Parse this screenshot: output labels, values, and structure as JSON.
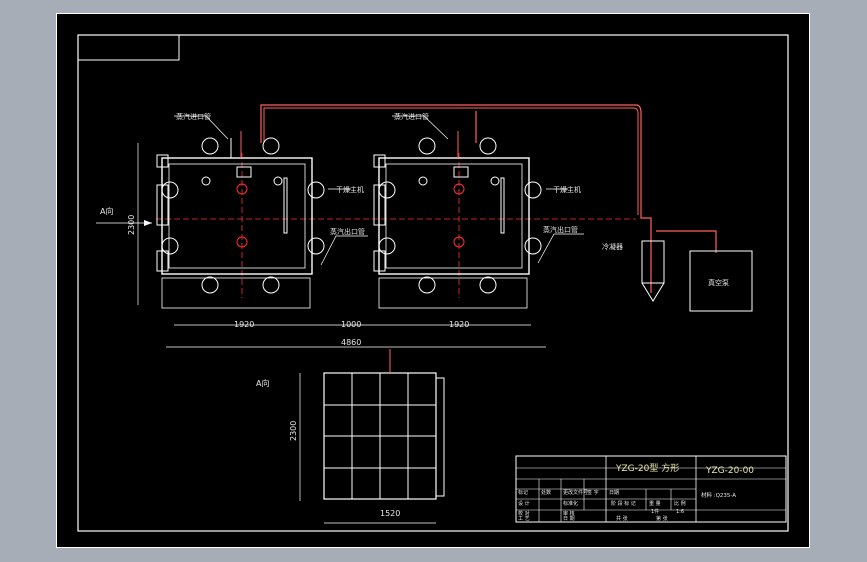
{
  "labels": {
    "steam_inlet_1": "蒸汽进口管",
    "steam_inlet_2": "蒸汽进口管",
    "steam_outlet_1": "蒸汽出口管",
    "steam_outlet_2": "蒸汽出口管",
    "dryer_main_1": "干燥主机",
    "dryer_main_2": "干燥主机",
    "condenser": "冷凝器",
    "vacuum_pump": "真空泵",
    "view_a_arrow": "A向",
    "view_a_title": "A向"
  },
  "dimensions": {
    "height_front": "2300",
    "width_left": "1920",
    "gap": "1000",
    "width_right": "1920",
    "total": "4860",
    "height_side": "2300",
    "width_side": "1520"
  },
  "title_block": {
    "name": "YZG-20型 方形",
    "drawing_no": "YZG-20-00",
    "row1": [
      "标记",
      "处数",
      "更改文件号",
      "签 字",
      "日期"
    ],
    "row2": [
      "设 计",
      "",
      "标准化"
    ],
    "row3": [
      "校 对",
      "",
      "审 核"
    ],
    "row4": [
      "工 艺",
      "",
      "日 期"
    ],
    "stage_header": [
      "阶 段 标 记",
      "重 量",
      "比 例"
    ],
    "stage_values": [
      "",
      "1件",
      "1:6"
    ],
    "footer": [
      "共 张",
      "第 张"
    ],
    "material": "材料 :Q235-A"
  },
  "colors": {
    "background": "#000000",
    "frame_outer": "#a7adb6",
    "lines": "#ffffff",
    "centerline": "#ff3030",
    "pipe": "#ff6060",
    "text": "#e6e6e6"
  }
}
